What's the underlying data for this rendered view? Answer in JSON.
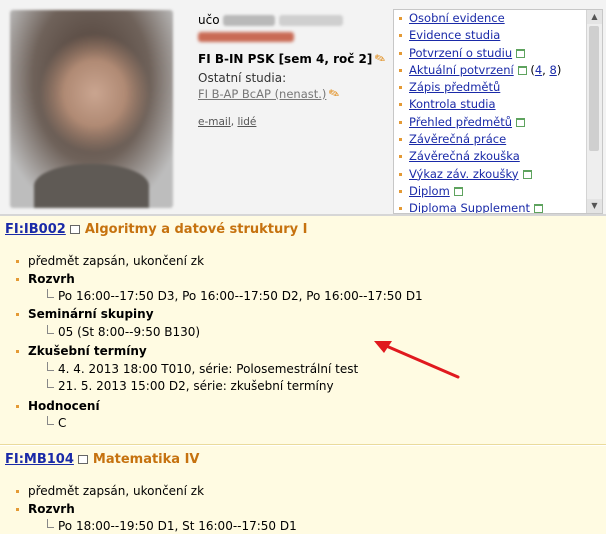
{
  "header": {
    "uco_label": "učo",
    "study": "FI B-IN PSK [sem 4, roč 2]",
    "other_studies_label": "Ostatní studia:",
    "other_study": "FI B-AP BcAP (nenast.)",
    "email_link": "e-mail",
    "people_link": "lidé",
    "separator": ","
  },
  "menu": {
    "items": [
      {
        "label": "Osobní evidence"
      },
      {
        "label": "Evidence studia"
      },
      {
        "label": "Potvrzení o studiu"
      },
      {
        "label": "Aktuální potvrzení",
        "extra_open": "(",
        "link1": "4",
        "sep": ",",
        "link2": "8",
        "extra_close": ")"
      },
      {
        "label": "Zápis předmětů"
      },
      {
        "label": "Kontrola studia"
      },
      {
        "label": "Přehled předmětů"
      },
      {
        "label": "Závěrečná práce"
      },
      {
        "label": "Závěrečná zkouška"
      },
      {
        "label": "Výkaz záv. zkoušky"
      },
      {
        "label": "Diplom"
      },
      {
        "label": "Diploma Supplement"
      }
    ]
  },
  "courses": [
    {
      "code": "FI:IB002",
      "name": "Algoritmy a datové struktury I",
      "status": "předmět zapsán, ukončení zk",
      "schedule_label": "Rozvrh",
      "schedule": "Po 16:00--17:50 D3, Po 16:00--17:50 D2, Po 16:00--17:50 D1",
      "seminar_label": "Seminární skupiny",
      "seminar": "05 (St 8:00--9:50 B130)",
      "exams_label": "Zkušební termíny",
      "exams": [
        "4. 4. 2013 18:00 T010, série: Polosemestrální test",
        "21. 5. 2013 15:00 D2, série: zkušební termíny"
      ],
      "grading_label": "Hodnocení",
      "grading": "C"
    },
    {
      "code": "FI:MB104",
      "name": "Matematika IV",
      "status": "předmět zapsán, ukončení zk",
      "schedule_label": "Rozvrh",
      "schedule": "Po 18:00--19:50 D1, St 16:00--17:50 D1"
    }
  ],
  "colors": {
    "accent_orange": "#c6720f",
    "link_blue": "#1a2aa8",
    "arrow_red": "#e0191e",
    "course_bg": "#fffbe2"
  }
}
